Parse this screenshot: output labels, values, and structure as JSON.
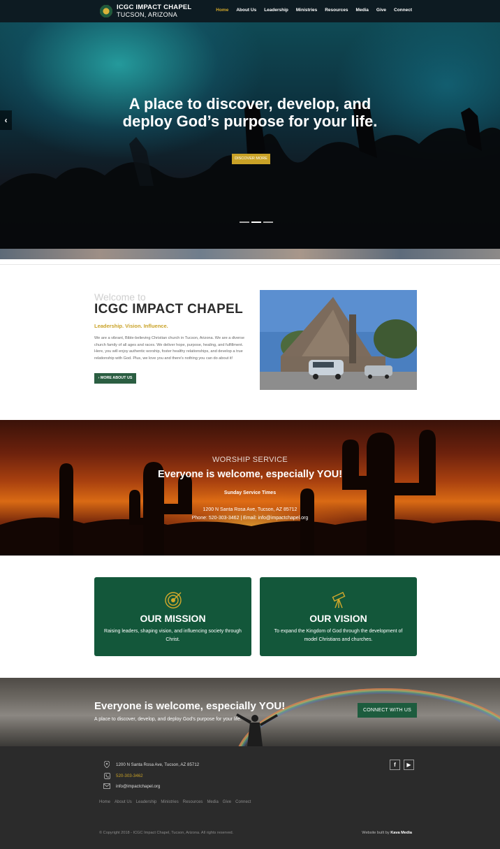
{
  "nav": {
    "brand_title": "ICGC IMPACT CHAPEL",
    "brand_sub": "TUCSON, ARIZONA",
    "links": [
      "Home",
      "About Us",
      "Leadership",
      "Ministries",
      "Resources",
      "Media",
      "Give",
      "Connect"
    ],
    "active": "Home"
  },
  "hero": {
    "headline": "A place to discover, develop, and deploy God’s purpose for your life.",
    "button": "DISCOVER MORE",
    "prev_icon": "chevron-left-icon",
    "slides": 3,
    "active_slide": 2
  },
  "welcome": {
    "small": "Welcome to",
    "title": "ICGC IMPACT CHAPEL",
    "tagline": "Leadership. Vision. Influence.",
    "paragraph": "We are a vibrant, Bible-believing Christian church in Tucson, Arizona. We are a diverse church family of all ages and races. We deliver hope, purpose, healing, and fulfillment. Here, you will enjoy authentic worship, foster healthy relationships, and develop a true relationship with God. Plus, we love you and there's nothing you can do about it!",
    "button": "MORE ABOUT US"
  },
  "worship": {
    "label": "WORSHIP SERVICE",
    "title": "Everyone is welcome, especially YOU!",
    "times": "Sunday Service Times",
    "address": "1200 N Santa Rosa Ave, Tucson, AZ 85712",
    "contact": "Phone: 520-303-3462 | Email: info@impactchapel.org"
  },
  "mission": {
    "title": "OUR MISSION",
    "text": "Raising leaders, shaping vision, and influencing society through Christ.",
    "icon": "target-icon"
  },
  "vision": {
    "title": "OUR VISION",
    "text": "To expand the Kingdom of God through the development of model Christians and churches.",
    "icon": "telescope-icon"
  },
  "cta": {
    "title": "Everyone is welcome, especially YOU!",
    "sub": "A place to discover, develop, and deploy God’s purpose for your life.",
    "button": "CONNECT WITH US"
  },
  "footer": {
    "address": "1200 N Santa Rosa Ave, Tucson, AZ 85712",
    "phone": "520-303-3462",
    "email": "info@impactchapel.org",
    "social": [
      "f",
      "▶"
    ],
    "links": [
      "Home",
      "About Us",
      "Leadership",
      "Ministries",
      "Resources",
      "Media",
      "Give",
      "Connect"
    ],
    "copyright": "© Copyright 2018 - ICGC Impact Chapel, Tucson, Arizona. All rights reserved.",
    "built_prefix": "Website built by",
    "built_by": "Kava Media"
  },
  "colors": {
    "gold": "#c9a227",
    "green": "#13573a",
    "nav_bg": "#0d1b22",
    "footer_bg": "#2b2b2b"
  }
}
